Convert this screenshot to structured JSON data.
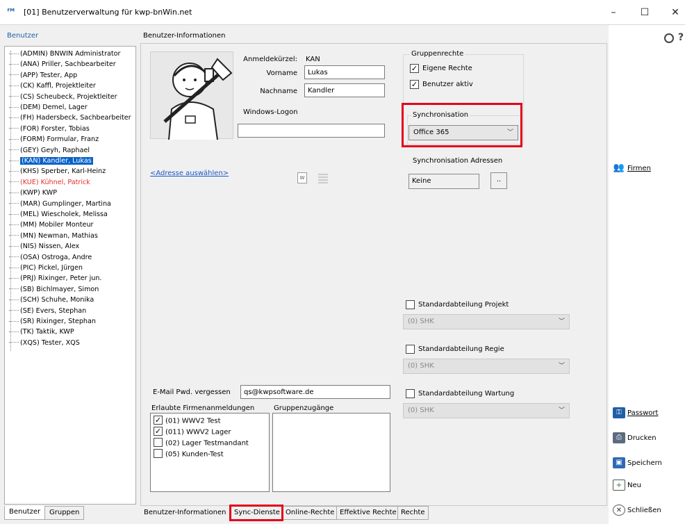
{
  "window": {
    "icon": "kwp-logo-icon",
    "title": "[01] Benutzerverwaltung für kwp-bnWin.net",
    "minimize": "–",
    "maximize": "☐",
    "close": "✕"
  },
  "left": {
    "header": "Benutzer",
    "users": [
      "(ADMIN) BNWIN Administrator",
      "(ANA) Priller, Sachbearbeiter",
      "(APP) Tester, App",
      "(CK) Kaffl, Projektleiter",
      "(CS) Scheubeck, Projektleiter",
      "(DEM) Demel, Lager",
      "(FH) Hadersbeck, Sachbearbeiter",
      "(FOR) Forster, Tobias",
      "(FORM) Formular, Franz",
      "(GEY) Geyh, Raphael",
      "(KAN) Kandler, Lukas",
      "(KHS) Sperber, Karl-Heinz",
      "(KUE) Kühnel, Patrick",
      "(KWP) KWP",
      "(MAR) Gumplinger, Martina",
      "(MEL) Wiescholek, Melissa",
      "(MM) Mobiler Monteur",
      "(MN) Newman, Mathias",
      "(NIS) Nissen, Alex",
      "(OSA) Ostroga, Andre",
      "(PIC) Pickel, Jürgen",
      "(PRJ) Rixinger, Peter jun.",
      "(SB) Bichlmayer, Simon",
      "(SCH) Schuhe, Monika",
      "(SE) Evers, Stephan",
      "(SR) Rixinger, Stephan",
      "(TK) Taktik, KWP",
      "(XQS) Tester, XQS"
    ],
    "selected_index": 10,
    "red_index": 12,
    "tabs": [
      "Benutzer",
      "Gruppen"
    ]
  },
  "main": {
    "header": "Benutzer-Informationen",
    "anmeldekuerzel_label": "Anmeldekürzel:",
    "anmeldekuerzel_value": "KAN",
    "vorname_label": "Vorname",
    "vorname_value": "Lukas",
    "nachname_label": "Nachname",
    "nachname_value": "Kandler",
    "windows_logon_label": "Windows-Logon",
    "windows_logon_value": "",
    "address_link": "<Adresse auswählen>",
    "email_label": "E-Mail Pwd. vergessen",
    "email_value": "qs@kwpsoftware.de",
    "firmen_label": "Erlaubte Firmenanmeldungen",
    "firmen": [
      {
        "label": "(01) WWV2 Test",
        "checked": true
      },
      {
        "label": "(011) WWV2 Lager",
        "checked": true
      },
      {
        "label": "(02) Lager Testmandant",
        "checked": false
      },
      {
        "label": "(05) Kunden-Test",
        "checked": false
      }
    ],
    "gruppen_label": "Gruppenzugänge"
  },
  "rights": {
    "group_title": "Gruppenrechte",
    "eigene_rechte": "Eigene Rechte",
    "benutzer_aktiv": "Benutzer aktiv",
    "sync_title": "Synchronisation",
    "sync_value": "Office 365",
    "sync_addr_title": "Synchronisation Adressen",
    "sync_addr_value": "Keine",
    "sync_addr_button": "..",
    "std_projekt": "Standardabteilung Projekt",
    "std_projekt_value": "(0) SHK",
    "std_regie": "Standardabteilung Regie",
    "std_regie_value": "(0) SHK",
    "std_wartung": "Standardabteilung Wartung",
    "std_wartung_value": "(0) SHK"
  },
  "bottom_tabs": [
    "Benutzer-Informationen",
    "Sync-Dienste",
    "Online-Rechte",
    "Effektive Rechte",
    "Rechte"
  ],
  "right": {
    "firmen": "Firmen",
    "passwort": "Passwort",
    "drucken": "Drucken",
    "speichern": "Speichern",
    "neu": "Neu",
    "schliessen": "Schließen",
    "help": "?"
  },
  "colors": {
    "accent": "#0a62c9",
    "highlight_box": "#e3001b",
    "red_user": "#e32f2f",
    "link": "#1a57c9"
  }
}
